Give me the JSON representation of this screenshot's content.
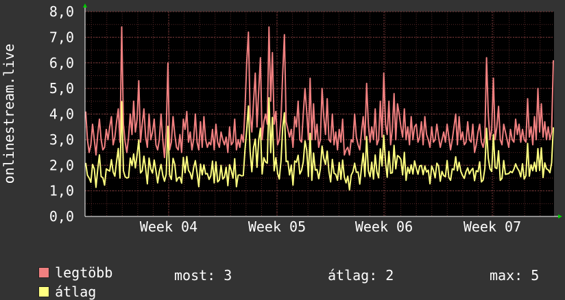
{
  "chart_data": {
    "type": "line",
    "ylabel": "onlinestream.live",
    "ylim": [
      0,
      8
    ],
    "y_ticks": [
      "0,0",
      "1,0",
      "2,0",
      "3,0",
      "4,0",
      "5,0",
      "6,0",
      "7,0",
      "8,0"
    ],
    "x_ticks": [
      "Week 04",
      "Week 05",
      "Week 06",
      "Week 07"
    ],
    "grid": true,
    "colors": {
      "background": "#333333",
      "plot": "#000000",
      "grid": "#5a2a2a",
      "axis": "#ffffff",
      "arrow": "#00cc00"
    },
    "series": [
      {
        "name": "legtöbb",
        "color": "#f08080",
        "values": [
          4.1,
          3.0,
          2.5,
          2.8,
          3.6,
          3.0,
          2.4,
          3.2,
          3.8,
          3.0,
          2.6,
          2.7,
          3.4,
          3.0,
          3.5,
          3.9,
          2.8,
          3.1,
          3.7,
          4.2,
          2.9,
          7.4,
          3.6,
          2.9,
          2.5,
          3.1,
          4.0,
          3.2,
          4.5,
          3.3,
          3.8,
          5.3,
          2.9,
          3.6,
          4.2,
          3.1,
          2.7,
          4.0,
          3.0,
          3.3,
          3.8,
          2.8,
          2.6,
          3.0,
          4.0,
          3.0,
          2.3,
          3.3,
          6.0,
          2.6,
          2.9,
          3.9,
          3.2,
          2.7,
          2.6,
          3.2,
          2.5,
          3.8,
          3.4,
          4.1,
          2.9,
          3.3,
          2.6,
          3.0,
          4.0,
          2.9,
          2.6,
          3.7,
          2.7,
          3.9,
          3.0,
          2.7,
          2.9,
          2.8,
          3.4,
          2.6,
          3.6,
          2.9,
          2.7,
          3.3,
          3.0,
          2.8,
          3.1,
          2.5,
          3.5,
          2.8,
          2.9,
          3.8,
          2.6,
          3.0,
          2.7,
          3.2,
          2.9,
          4.2,
          6.0,
          7.2,
          4.0,
          3.3,
          4.5,
          5.6,
          3.5,
          4.9,
          6.2,
          3.0,
          3.7,
          4.0,
          3.6,
          7.4,
          4.5,
          6.4,
          3.6,
          4.1,
          2.8,
          3.0,
          3.8,
          5.6,
          7.1,
          3.7,
          3.4,
          3.1,
          3.4,
          2.7,
          3.9,
          3.5,
          4.5,
          3.0,
          2.9,
          4.0,
          5.0,
          4.1,
          3.0,
          5.4,
          3.0,
          4.4,
          3.0,
          3.6,
          2.7,
          3.0,
          5.0,
          3.9,
          3.2,
          4.6,
          3.0,
          2.9,
          4.0,
          2.8,
          3.3,
          2.6,
          3.4,
          2.9,
          3.8,
          2.4,
          2.6,
          2.7,
          2.4,
          3.0,
          2.9,
          4.0,
          3.1,
          2.8,
          2.6,
          3.3,
          3.9,
          3.0,
          5.2,
          3.6,
          2.9,
          3.5,
          3.0,
          4.2,
          2.8,
          3.0,
          4.5,
          3.1,
          5.6,
          3.6,
          3.2,
          4.5,
          2.8,
          3.4,
          4.8,
          3.0,
          4.4,
          4.0,
          3.5,
          3.1,
          4.2,
          3.0,
          3.5,
          2.8,
          3.9,
          3.0,
          3.5,
          3.6,
          2.9,
          3.1,
          3.7,
          2.8,
          3.9,
          3.2,
          3.0,
          2.7,
          3.5,
          2.9,
          3.0,
          3.6,
          3.1,
          2.7,
          3.0,
          3.3,
          2.9,
          3.6,
          3.1,
          2.6,
          3.0,
          3.5,
          4.0,
          2.8,
          3.9,
          3.0,
          3.3,
          2.8,
          2.9,
          3.7,
          3.0,
          2.9,
          3.6,
          2.5,
          2.8,
          3.3,
          3.6,
          2.9,
          2.7,
          3.1,
          6.2,
          4.0,
          3.0,
          3.4,
          5.4,
          3.0,
          3.5,
          4.3,
          3.0,
          2.8,
          3.6,
          3.3,
          3.0,
          2.7,
          3.4,
          3.0,
          2.9,
          3.8,
          3.2,
          3.6,
          2.9,
          3.4,
          3.0,
          2.9,
          4.6,
          3.1,
          3.5,
          2.8,
          3.9,
          3.0,
          5.0,
          3.3,
          4.4,
          3.1,
          3.7,
          3.0,
          3.5,
          3.0,
          3.3,
          6.1
        ],
        "scale": 1
      },
      {
        "name": "átlag",
        "color": "#ffff80"
      }
    ],
    "legend_placement": "bottom-left"
  },
  "legend": {
    "max_label": "legtöbb",
    "avg_label": "átlag",
    "most_text": "most: 3",
    "avg_text": "átlag: 2",
    "max_text": "max: 5"
  }
}
